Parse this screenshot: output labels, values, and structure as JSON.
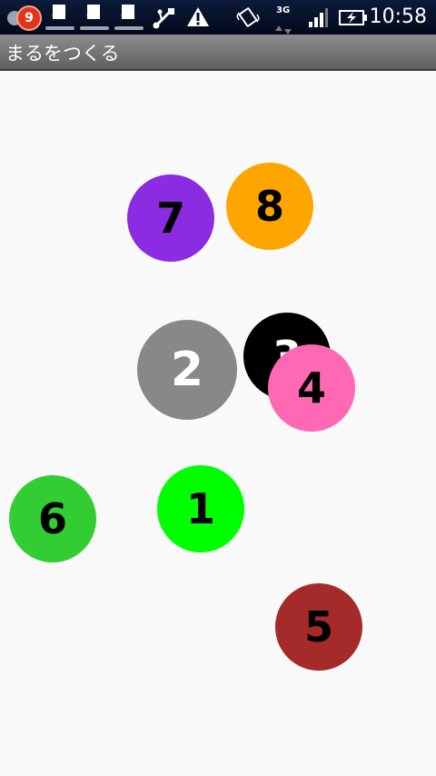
{
  "status_bar": {
    "notification_count": "9",
    "network": "3G",
    "time": "10:58"
  },
  "app": {
    "title": "まるをつくる"
  },
  "circles": [
    {
      "label": "7",
      "color": "#8b2be2",
      "text_color": "#000000"
    },
    {
      "label": "8",
      "color": "#ffa500",
      "text_color": "#000000"
    },
    {
      "label": "2",
      "color": "#888888",
      "text_color": "#ffffff"
    },
    {
      "label": "3",
      "color": "#000000",
      "text_color": "#ffffff"
    },
    {
      "label": "4",
      "color": "#ff69b4",
      "text_color": "#000000"
    },
    {
      "label": "6",
      "color": "#32cd32",
      "text_color": "#000000"
    },
    {
      "label": "1",
      "color": "#00ff00",
      "text_color": "#000000"
    },
    {
      "label": "5",
      "color": "#a52a2a",
      "text_color": "#000000"
    }
  ]
}
